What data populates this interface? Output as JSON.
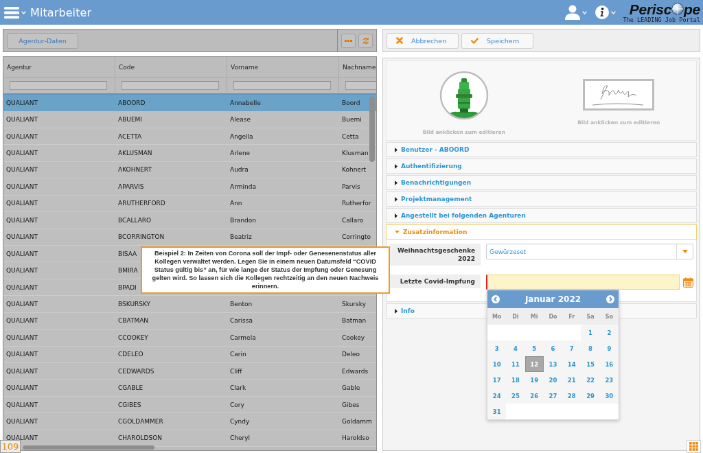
{
  "header": {
    "title": "Mitarbeiter",
    "logo": {
      "lead": "Perisc",
      "tail": "pe",
      "tagline": "The LEADING Job Portal"
    }
  },
  "left_panel": {
    "toolbar": {
      "button": "Agentur-Daten"
    },
    "table": {
      "columns": [
        "Agentur",
        "Code",
        "Vorname",
        "Nachname"
      ],
      "rows": [
        {
          "cells": [
            "QUALIANT",
            "ABOORD",
            "Annabelle",
            "Boord"
          ],
          "selected": true
        },
        {
          "cells": [
            "QUALIANT",
            "ABUEMI",
            "Alease",
            "Buemi"
          ],
          "selected": false
        },
        {
          "cells": [
            "QUALIANT",
            "ACETTA",
            "Angella",
            "Cetta"
          ],
          "selected": false
        },
        {
          "cells": [
            "QUALIANT",
            "AKLUSMAN",
            "Arlene",
            "Klusman"
          ],
          "selected": false
        },
        {
          "cells": [
            "QUALIANT",
            "AKOHNERT",
            "Audra",
            "Kohnert"
          ],
          "selected": false
        },
        {
          "cells": [
            "QUALIANT",
            "APARVIS",
            "Arminda",
            "Parvis"
          ],
          "selected": false
        },
        {
          "cells": [
            "QUALIANT",
            "ARUTHERFORD",
            "Ann",
            "Rutherfor"
          ],
          "selected": false
        },
        {
          "cells": [
            "QUALIANT",
            "BCALLARO",
            "Brandon",
            "Callaro"
          ],
          "selected": false
        },
        {
          "cells": [
            "QUALIANT",
            "BCORRINGTON",
            "Beatriz",
            "Corringto"
          ],
          "selected": false
        },
        {
          "cells": [
            "QUALIANT",
            "BISAA"
          ],
          "selected": false
        },
        {
          "cells": [
            "QUALIANT",
            "BMIRA"
          ],
          "selected": false
        },
        {
          "cells": [
            "QUALIANT",
            "BPADI"
          ],
          "selected": false
        },
        {
          "cells": [
            "QUALIANT",
            "BSKURSKY",
            "Benton",
            "Skursky"
          ],
          "selected": false
        },
        {
          "cells": [
            "QUALIANT",
            "CBATMAN",
            "Carissa",
            "Batman"
          ],
          "selected": false
        },
        {
          "cells": [
            "QUALIANT",
            "CCOOKEY",
            "Carmela",
            "Cookey"
          ],
          "selected": false
        },
        {
          "cells": [
            "QUALIANT",
            "CDELEO",
            "Carin",
            "Deleo"
          ],
          "selected": false
        },
        {
          "cells": [
            "QUALIANT",
            "CEDWARDS",
            "Cliff",
            "Edwards"
          ],
          "selected": false
        },
        {
          "cells": [
            "QUALIANT",
            "CGABLE",
            "Clark",
            "Gable"
          ],
          "selected": false
        },
        {
          "cells": [
            "QUALIANT",
            "CGIBES",
            "Cory",
            "Gibes"
          ],
          "selected": false
        },
        {
          "cells": [
            "QUALIANT",
            "CGOLDAMMER",
            "Cyndy",
            "Goldamm"
          ],
          "selected": false
        },
        {
          "cells": [
            "QUALIANT",
            "CHAROLDSON",
            "Cheryl",
            "Haroldso"
          ],
          "selected": false
        }
      ]
    },
    "record_count": "109"
  },
  "callout": {
    "text": "Beispiel 2: In Zeiten von Corona soll der Impf- oder Genesenenstatus aller Kollegen verwaltet werden. Legen Sie in einem neuen Datumsfeld “COVID Status gültig bis” an, für wie lange der Status der Impfung oder Genesung gelten wird. So lassen sich die Kollegen rechtzeitig an den neuen Nachweis erinnern."
  },
  "right_panel": {
    "toolbar": [
      {
        "kind": "cancel",
        "label": "Abbrechen"
      },
      {
        "kind": "save",
        "label": "Speichern"
      }
    ],
    "images": [
      {
        "kind": "avatar",
        "caption": "Bild anklicken zum editieren"
      },
      {
        "kind": "signature",
        "caption": "Bild anklicken zum editieren"
      }
    ],
    "sections": [
      {
        "title": "Benutzer - ABOORD",
        "expanded": false
      },
      {
        "title": "Authentifizierung",
        "expanded": false
      },
      {
        "title": "Benachrichtigungen",
        "expanded": false
      },
      {
        "title": "Projektmanagement",
        "expanded": false
      },
      {
        "title": "Angestellt bei folgenden Agenturen",
        "expanded": false
      },
      {
        "title": "Zusatzinformation",
        "expanded": true,
        "fields": [
          {
            "kind": "select",
            "label": "Weihnachtsgeschenke 2022",
            "value": "Gewürzeset"
          },
          {
            "kind": "date",
            "label": "Letzte Covid-Impfung",
            "focused": true,
            "required": true,
            "date_picker": {
              "title": "Januar 2022",
              "weekdays": [
                "Mo",
                "Di",
                "Mi",
                "Do",
                "Fr",
                "Sa",
                "So"
              ],
              "weeks": [
                [
                  {
                    "kind": "blank"
                  },
                  {
                    "kind": "blank"
                  },
                  {
                    "kind": "blank"
                  },
                  {
                    "kind": "blank"
                  },
                  {
                    "kind": "blank"
                  },
                  {
                    "kind": "day",
                    "day": "1",
                    "selected": false
                  },
                  {
                    "kind": "day",
                    "day": "2",
                    "selected": false
                  }
                ],
                [
                  {
                    "kind": "day",
                    "day": "3",
                    "selected": false
                  },
                  {
                    "kind": "day",
                    "day": "4",
                    "selected": false
                  },
                  {
                    "kind": "day",
                    "day": "5",
                    "selected": false
                  },
                  {
                    "kind": "day",
                    "day": "6",
                    "selected": false
                  },
                  {
                    "kind": "day",
                    "day": "7",
                    "selected": false
                  },
                  {
                    "kind": "day",
                    "day": "8",
                    "selected": false
                  },
                  {
                    "kind": "day",
                    "day": "9",
                    "selected": false
                  }
                ],
                [
                  {
                    "kind": "day",
                    "day": "10",
                    "selected": false
                  },
                  {
                    "kind": "day",
                    "day": "11",
                    "selected": false
                  },
                  {
                    "kind": "day",
                    "day": "12",
                    "selected": true
                  },
                  {
                    "kind": "day",
                    "day": "13",
                    "selected": false
                  },
                  {
                    "kind": "day",
                    "day": "14",
                    "selected": false
                  },
                  {
                    "kind": "day",
                    "day": "15",
                    "selected": false
                  },
                  {
                    "kind": "day",
                    "day": "16",
                    "selected": false
                  }
                ],
                [
                  {
                    "kind": "day",
                    "day": "17",
                    "selected": false
                  },
                  {
                    "kind": "day",
                    "day": "18",
                    "selected": false
                  },
                  {
                    "kind": "day",
                    "day": "19",
                    "selected": false
                  },
                  {
                    "kind": "day",
                    "day": "20",
                    "selected": false
                  },
                  {
                    "kind": "day",
                    "day": "21",
                    "selected": false
                  },
                  {
                    "kind": "day",
                    "day": "22",
                    "selected": false
                  },
                  {
                    "kind": "day",
                    "day": "23",
                    "selected": false
                  }
                ],
                [
                  {
                    "kind": "day",
                    "day": "24",
                    "selected": false
                  },
                  {
                    "kind": "day",
                    "day": "25",
                    "selected": false
                  },
                  {
                    "kind": "day",
                    "day": "26",
                    "selected": false
                  },
                  {
                    "kind": "day",
                    "day": "27",
                    "selected": false
                  },
                  {
                    "kind": "day",
                    "day": "28",
                    "selected": false
                  },
                  {
                    "kind": "day",
                    "day": "29",
                    "selected": false
                  },
                  {
                    "kind": "day",
                    "day": "30",
                    "selected": false
                  }
                ],
                [
                  {
                    "kind": "day",
                    "day": "31",
                    "selected": false
                  }
                ]
              ]
            }
          }
        ]
      },
      {
        "title": "Info",
        "expanded": false
      }
    ]
  }
}
